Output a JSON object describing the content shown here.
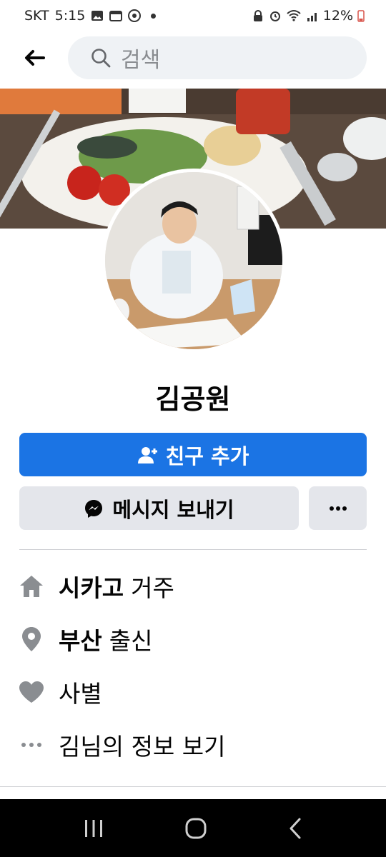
{
  "status_bar": {
    "carrier": "SKT",
    "time": "5:15",
    "battery": "12%"
  },
  "search": {
    "placeholder": "검색"
  },
  "profile": {
    "name": "김공원"
  },
  "actions": {
    "add_friend_label": "친구 추가",
    "message_label": "메시지 보내기"
  },
  "info": {
    "lives_in_place": "시카고",
    "lives_in_suffix": "거주",
    "from_place": "부산",
    "from_suffix": "출신",
    "relationship": "사별",
    "about_link": "김님의 정보 보기"
  },
  "colors": {
    "primary": "#1b74e4",
    "secondary_button": "#e4e6eb",
    "icon_gray": "#606770"
  }
}
